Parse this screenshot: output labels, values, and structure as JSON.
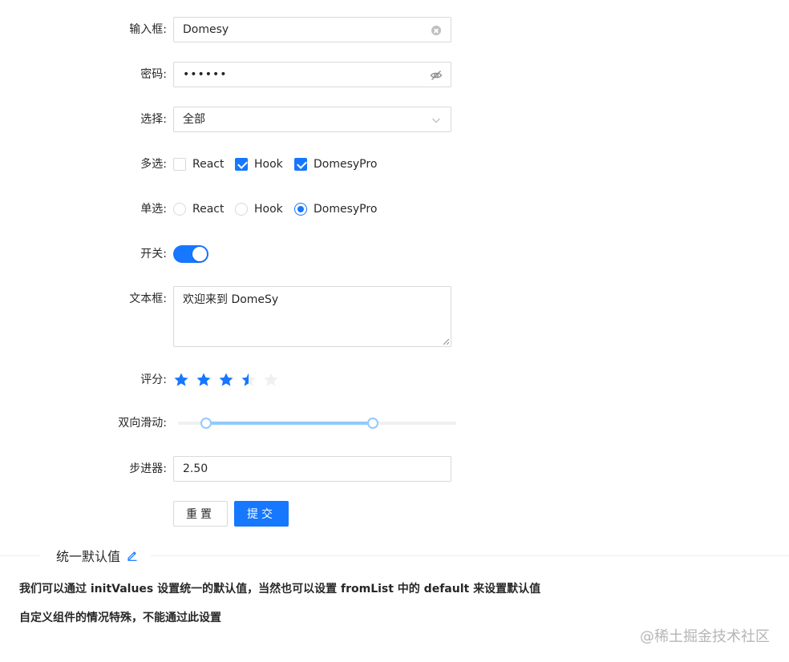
{
  "form": {
    "input": {
      "label": "输入框:",
      "value": "Domesy",
      "clear_icon": "close-circle-icon"
    },
    "password": {
      "label": "密码:",
      "value": "••••••",
      "toggle_icon": "eye-invisible-icon"
    },
    "select": {
      "label": "选择:",
      "value": "全部",
      "arrow_icon": "chevron-down-icon"
    },
    "checkbox": {
      "label": "多选:",
      "options": [
        {
          "label": "React",
          "checked": false
        },
        {
          "label": "Hook",
          "checked": true
        },
        {
          "label": "DomesyPro",
          "checked": true
        }
      ]
    },
    "radio": {
      "label": "单选:",
      "options": [
        {
          "label": "React",
          "checked": false
        },
        {
          "label": "Hook",
          "checked": false
        },
        {
          "label": "DomesyPro",
          "checked": true
        }
      ]
    },
    "switch": {
      "label": "开关:",
      "on": true
    },
    "textarea": {
      "label": "文本框:",
      "value": "欢迎来到 DomeSy"
    },
    "rate": {
      "label": "评分:",
      "value": 3.5,
      "max": 5
    },
    "slider": {
      "label": "双向滑动:",
      "range": [
        10,
        70
      ],
      "min": 0,
      "max": 100
    },
    "stepper": {
      "label": "步进器:",
      "value": "2.50"
    },
    "buttons": {
      "reset_label": "重置",
      "submit_label": "提交"
    }
  },
  "section": {
    "title": "统一默认值",
    "edit_icon": "edit-icon",
    "paragraphs": [
      "我们可以通过 initValues 设置统一的默认值，当然也可以设置 fromList 中的 default 来设置默认值",
      "自定义组件的情况特殊，不能通过此设置"
    ]
  },
  "watermark": "@稀土掘金技术社区",
  "colors": {
    "primary": "#1677ff",
    "slider_track": "#91caff",
    "star_inactive": "#f0f0f0",
    "border": "#d9d9d9"
  }
}
